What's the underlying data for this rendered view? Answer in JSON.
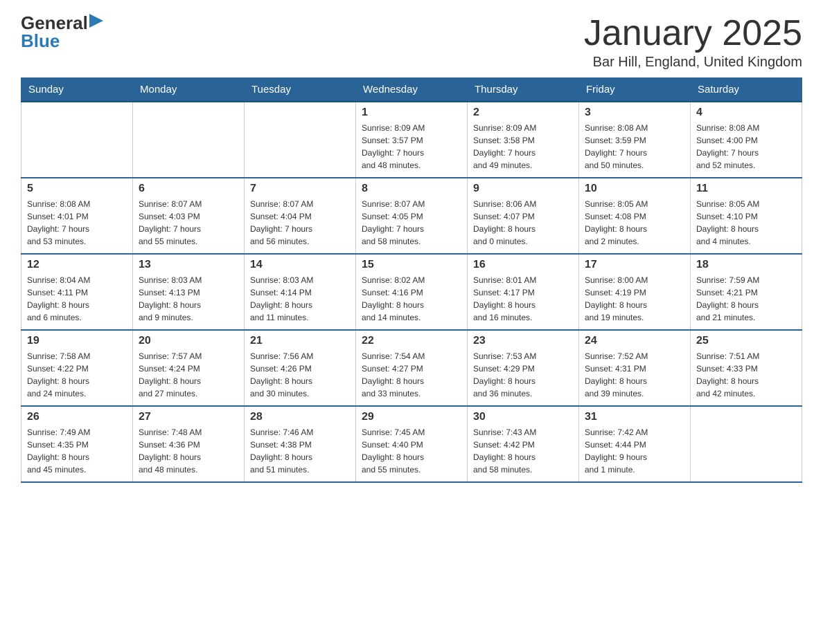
{
  "header": {
    "logo_text_general": "General",
    "logo_text_blue": "Blue",
    "month_title": "January 2025",
    "location": "Bar Hill, England, United Kingdom"
  },
  "calendar": {
    "days_of_week": [
      "Sunday",
      "Monday",
      "Tuesday",
      "Wednesday",
      "Thursday",
      "Friday",
      "Saturday"
    ],
    "weeks": [
      [
        {
          "day": "",
          "info": ""
        },
        {
          "day": "",
          "info": ""
        },
        {
          "day": "",
          "info": ""
        },
        {
          "day": "1",
          "info": "Sunrise: 8:09 AM\nSunset: 3:57 PM\nDaylight: 7 hours\nand 48 minutes."
        },
        {
          "day": "2",
          "info": "Sunrise: 8:09 AM\nSunset: 3:58 PM\nDaylight: 7 hours\nand 49 minutes."
        },
        {
          "day": "3",
          "info": "Sunrise: 8:08 AM\nSunset: 3:59 PM\nDaylight: 7 hours\nand 50 minutes."
        },
        {
          "day": "4",
          "info": "Sunrise: 8:08 AM\nSunset: 4:00 PM\nDaylight: 7 hours\nand 52 minutes."
        }
      ],
      [
        {
          "day": "5",
          "info": "Sunrise: 8:08 AM\nSunset: 4:01 PM\nDaylight: 7 hours\nand 53 minutes."
        },
        {
          "day": "6",
          "info": "Sunrise: 8:07 AM\nSunset: 4:03 PM\nDaylight: 7 hours\nand 55 minutes."
        },
        {
          "day": "7",
          "info": "Sunrise: 8:07 AM\nSunset: 4:04 PM\nDaylight: 7 hours\nand 56 minutes."
        },
        {
          "day": "8",
          "info": "Sunrise: 8:07 AM\nSunset: 4:05 PM\nDaylight: 7 hours\nand 58 minutes."
        },
        {
          "day": "9",
          "info": "Sunrise: 8:06 AM\nSunset: 4:07 PM\nDaylight: 8 hours\nand 0 minutes."
        },
        {
          "day": "10",
          "info": "Sunrise: 8:05 AM\nSunset: 4:08 PM\nDaylight: 8 hours\nand 2 minutes."
        },
        {
          "day": "11",
          "info": "Sunrise: 8:05 AM\nSunset: 4:10 PM\nDaylight: 8 hours\nand 4 minutes."
        }
      ],
      [
        {
          "day": "12",
          "info": "Sunrise: 8:04 AM\nSunset: 4:11 PM\nDaylight: 8 hours\nand 6 minutes."
        },
        {
          "day": "13",
          "info": "Sunrise: 8:03 AM\nSunset: 4:13 PM\nDaylight: 8 hours\nand 9 minutes."
        },
        {
          "day": "14",
          "info": "Sunrise: 8:03 AM\nSunset: 4:14 PM\nDaylight: 8 hours\nand 11 minutes."
        },
        {
          "day": "15",
          "info": "Sunrise: 8:02 AM\nSunset: 4:16 PM\nDaylight: 8 hours\nand 14 minutes."
        },
        {
          "day": "16",
          "info": "Sunrise: 8:01 AM\nSunset: 4:17 PM\nDaylight: 8 hours\nand 16 minutes."
        },
        {
          "day": "17",
          "info": "Sunrise: 8:00 AM\nSunset: 4:19 PM\nDaylight: 8 hours\nand 19 minutes."
        },
        {
          "day": "18",
          "info": "Sunrise: 7:59 AM\nSunset: 4:21 PM\nDaylight: 8 hours\nand 21 minutes."
        }
      ],
      [
        {
          "day": "19",
          "info": "Sunrise: 7:58 AM\nSunset: 4:22 PM\nDaylight: 8 hours\nand 24 minutes."
        },
        {
          "day": "20",
          "info": "Sunrise: 7:57 AM\nSunset: 4:24 PM\nDaylight: 8 hours\nand 27 minutes."
        },
        {
          "day": "21",
          "info": "Sunrise: 7:56 AM\nSunset: 4:26 PM\nDaylight: 8 hours\nand 30 minutes."
        },
        {
          "day": "22",
          "info": "Sunrise: 7:54 AM\nSunset: 4:27 PM\nDaylight: 8 hours\nand 33 minutes."
        },
        {
          "day": "23",
          "info": "Sunrise: 7:53 AM\nSunset: 4:29 PM\nDaylight: 8 hours\nand 36 minutes."
        },
        {
          "day": "24",
          "info": "Sunrise: 7:52 AM\nSunset: 4:31 PM\nDaylight: 8 hours\nand 39 minutes."
        },
        {
          "day": "25",
          "info": "Sunrise: 7:51 AM\nSunset: 4:33 PM\nDaylight: 8 hours\nand 42 minutes."
        }
      ],
      [
        {
          "day": "26",
          "info": "Sunrise: 7:49 AM\nSunset: 4:35 PM\nDaylight: 8 hours\nand 45 minutes."
        },
        {
          "day": "27",
          "info": "Sunrise: 7:48 AM\nSunset: 4:36 PM\nDaylight: 8 hours\nand 48 minutes."
        },
        {
          "day": "28",
          "info": "Sunrise: 7:46 AM\nSunset: 4:38 PM\nDaylight: 8 hours\nand 51 minutes."
        },
        {
          "day": "29",
          "info": "Sunrise: 7:45 AM\nSunset: 4:40 PM\nDaylight: 8 hours\nand 55 minutes."
        },
        {
          "day": "30",
          "info": "Sunrise: 7:43 AM\nSunset: 4:42 PM\nDaylight: 8 hours\nand 58 minutes."
        },
        {
          "day": "31",
          "info": "Sunrise: 7:42 AM\nSunset: 4:44 PM\nDaylight: 9 hours\nand 1 minute."
        },
        {
          "day": "",
          "info": ""
        }
      ]
    ]
  }
}
